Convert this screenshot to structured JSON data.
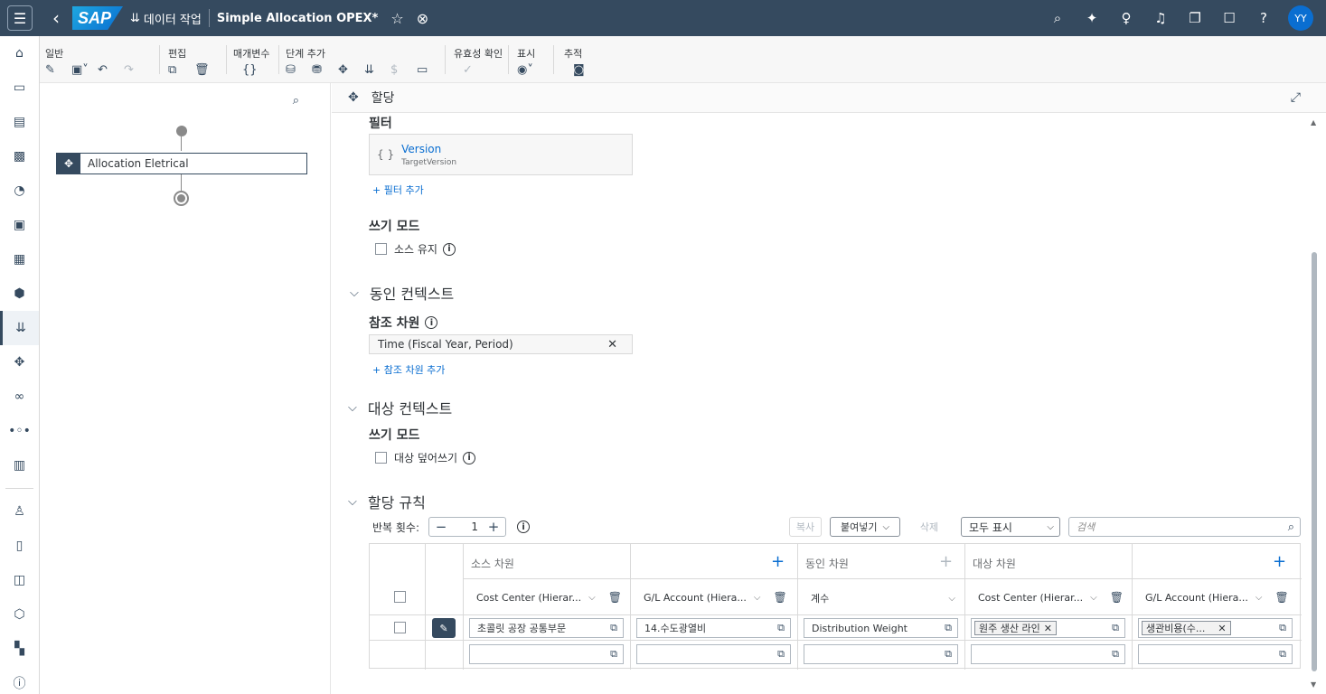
{
  "shell": {
    "app_icon": "⇊",
    "app_name": "데이터 작업",
    "doc_title": "Simple Allocation OPEX*",
    "avatar": "YY",
    "logo": "SAP"
  },
  "toolbar": {
    "groups": [
      {
        "label": "일반"
      },
      {
        "label": "편집"
      },
      {
        "label": "매개변수"
      },
      {
        "label": "단계 추가"
      },
      {
        "label": "유효성 확인"
      },
      {
        "label": "표시"
      },
      {
        "label": "추적"
      }
    ]
  },
  "tree": {
    "step_label": "Allocation Eletrical"
  },
  "detail": {
    "header_title": "할당",
    "filter_title": "필터",
    "filter_item_name": "Version",
    "filter_item_sub": "TargetVersion",
    "add_filter": "+ 필터 추가",
    "write_mode_title": "쓰기 모드",
    "keep_source": "소스 유지",
    "driver_context": "동인 컨텍스트",
    "ref_dim_title": "참조 차원",
    "ref_dim_value": "Time (Fiscal Year, Period)",
    "add_ref_dim": "+ 참조 차원 추가",
    "target_context": "대상 컨텍스트",
    "write_mode_title2": "쓰기 모드",
    "overwrite_target": "대상 덮어쓰기",
    "alloc_rules": "할당 규칙"
  },
  "rules": {
    "iterations_label": "반복 횟수:",
    "iterations_value": "1",
    "copy": "복사",
    "paste": "붙여넣기",
    "delete": "삭제",
    "show_all": "모두 표시",
    "search_placeholder": "검색",
    "headers": {
      "source": "소스 차원",
      "driver": "동인 차원",
      "target": "대상 차원"
    },
    "dims": {
      "src_cc": "Cost Center (Hierar...",
      "src_gl": "G/L Account (Hiera...",
      "driver_factor": "계수",
      "tgt_cc": "Cost Center (Hierar...",
      "tgt_gl": "G/L Account (Hiera..."
    },
    "row1": {
      "src_cc": "초콜릿 공장 공통부문",
      "src_gl": "14.수도광열비",
      "driver": "Distribution Weight",
      "tgt_cc": "원주 생산 라인",
      "tgt_gl": "생관비용(수..."
    }
  }
}
